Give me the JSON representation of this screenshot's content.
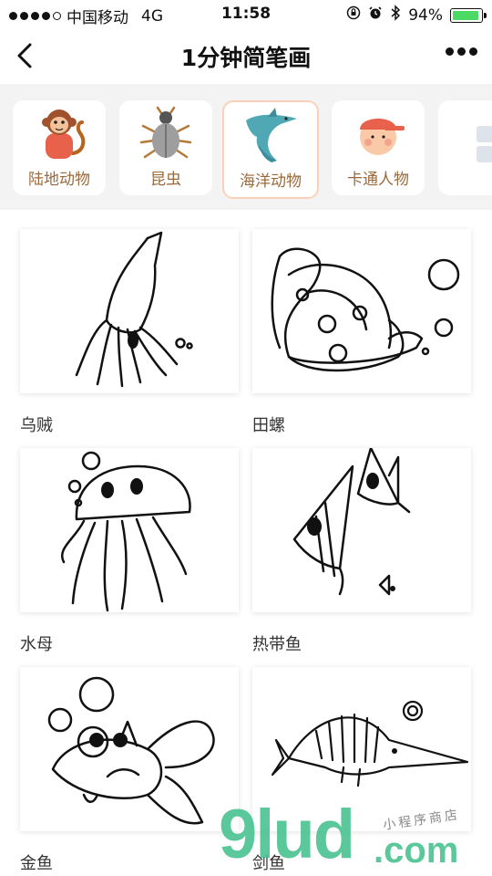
{
  "status": {
    "carrier": "中国移动",
    "network": "4G",
    "time": "11:58",
    "battery": "94%"
  },
  "nav": {
    "title": "1分钟简笔画"
  },
  "categories": [
    {
      "label": "陆地动物",
      "icon": "monkey-icon"
    },
    {
      "label": "昆虫",
      "icon": "beetle-icon"
    },
    {
      "label": "海洋动物",
      "icon": "shark-icon",
      "active": true
    },
    {
      "label": "卡通人物",
      "icon": "cartoon-boy-icon"
    },
    {
      "label": "",
      "icon": "grid-icon"
    }
  ],
  "items": [
    {
      "name": "乌贼"
    },
    {
      "name": "田螺"
    },
    {
      "name": "水母"
    },
    {
      "name": "热带鱼"
    },
    {
      "name": "金鱼"
    },
    {
      "name": "剑鱼"
    }
  ],
  "watermark": {
    "main": "9lud",
    "suffix": ".com",
    "tagline": "小程序商店"
  },
  "colors": {
    "accent_border": "#f8d2b8",
    "label_brown": "#9a6a3c",
    "strip_bg": "#f3f3f3",
    "watermark_green": "#3fbf8a"
  }
}
